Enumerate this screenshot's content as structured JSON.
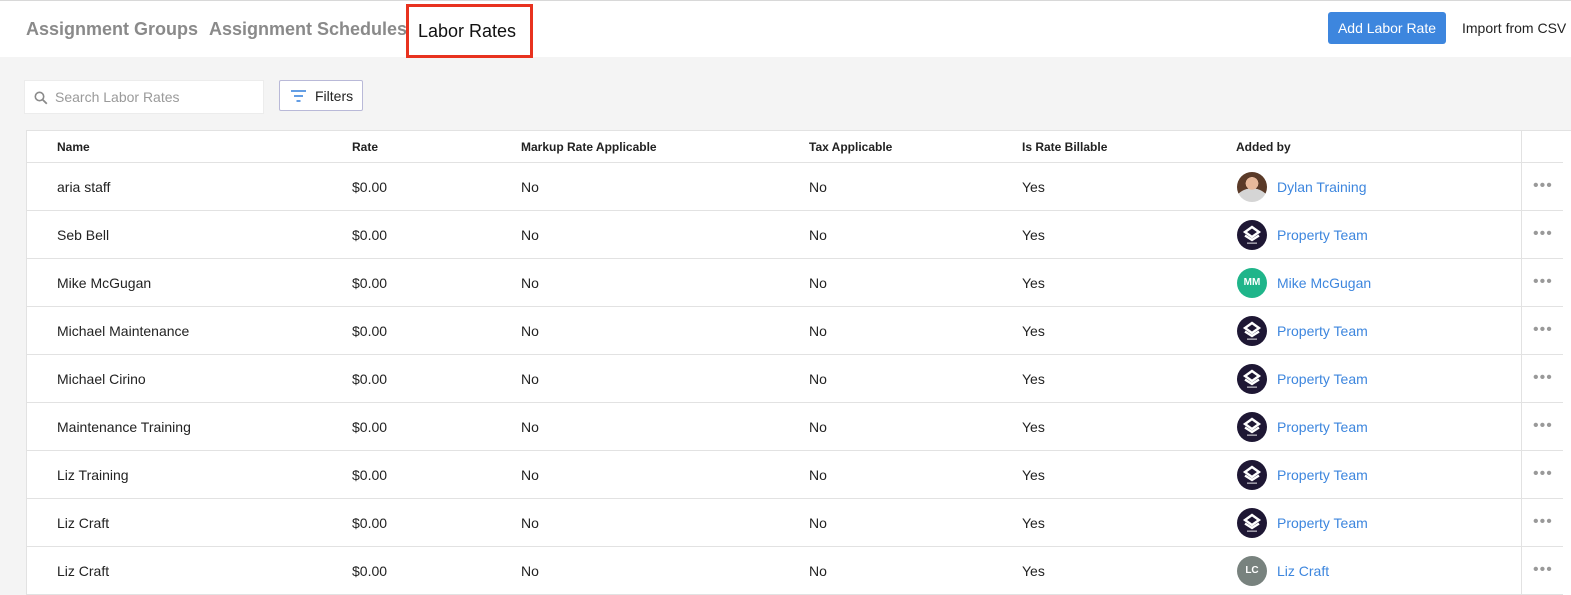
{
  "tabs": [
    {
      "label": "Assignment Groups"
    },
    {
      "label": "Assignment Schedules"
    },
    {
      "label": "Labor Rates"
    }
  ],
  "actions": {
    "add_label": "Add Labor Rate",
    "import_label": "Import from CSV"
  },
  "search": {
    "placeholder": "Search Labor Rates",
    "value": ""
  },
  "filters": {
    "label": "Filters"
  },
  "colors": {
    "accent": "#3d86de",
    "highlight": "#e8321f",
    "mm_avatar": "#1fb58a",
    "lc_avatar": "#78827e"
  },
  "table": {
    "columns": [
      "Name",
      "Rate",
      "Markup Rate Applicable",
      "Tax Applicable",
      "Is Rate Billable",
      "Added by"
    ],
    "rows": [
      {
        "name": "aria staff",
        "rate": "$0.00",
        "markup": "No",
        "tax": "No",
        "billable": "Yes",
        "added_by": "Dylan Training",
        "avatar": "photo",
        "initials": ""
      },
      {
        "name": "Seb Bell",
        "rate": "$0.00",
        "markup": "No",
        "tax": "No",
        "billable": "Yes",
        "added_by": "Property Team",
        "avatar": "logo",
        "initials": ""
      },
      {
        "name": "Mike McGugan",
        "rate": "$0.00",
        "markup": "No",
        "tax": "No",
        "billable": "Yes",
        "added_by": "Mike McGugan",
        "avatar": "initials",
        "initials": "MM"
      },
      {
        "name": "Michael Maintenance",
        "rate": "$0.00",
        "markup": "No",
        "tax": "No",
        "billable": "Yes",
        "added_by": "Property Team",
        "avatar": "logo",
        "initials": ""
      },
      {
        "name": "Michael Cirino",
        "rate": "$0.00",
        "markup": "No",
        "tax": "No",
        "billable": "Yes",
        "added_by": "Property Team",
        "avatar": "logo",
        "initials": ""
      },
      {
        "name": "Maintenance Training",
        "rate": "$0.00",
        "markup": "No",
        "tax": "No",
        "billable": "Yes",
        "added_by": "Property Team",
        "avatar": "logo",
        "initials": ""
      },
      {
        "name": "Liz Training",
        "rate": "$0.00",
        "markup": "No",
        "tax": "No",
        "billable": "Yes",
        "added_by": "Property Team",
        "avatar": "logo",
        "initials": ""
      },
      {
        "name": "Liz Craft",
        "rate": "$0.00",
        "markup": "No",
        "tax": "No",
        "billable": "Yes",
        "added_by": "Property Team",
        "avatar": "logo",
        "initials": ""
      },
      {
        "name": "Liz Craft",
        "rate": "$0.00",
        "markup": "No",
        "tax": "No",
        "billable": "Yes",
        "added_by": "Liz Craft",
        "avatar": "initials",
        "initials": "LC"
      }
    ]
  },
  "icons": {
    "search": "search-icon",
    "filter": "filter-icon",
    "row_menu": "more-horizontal-icon"
  }
}
